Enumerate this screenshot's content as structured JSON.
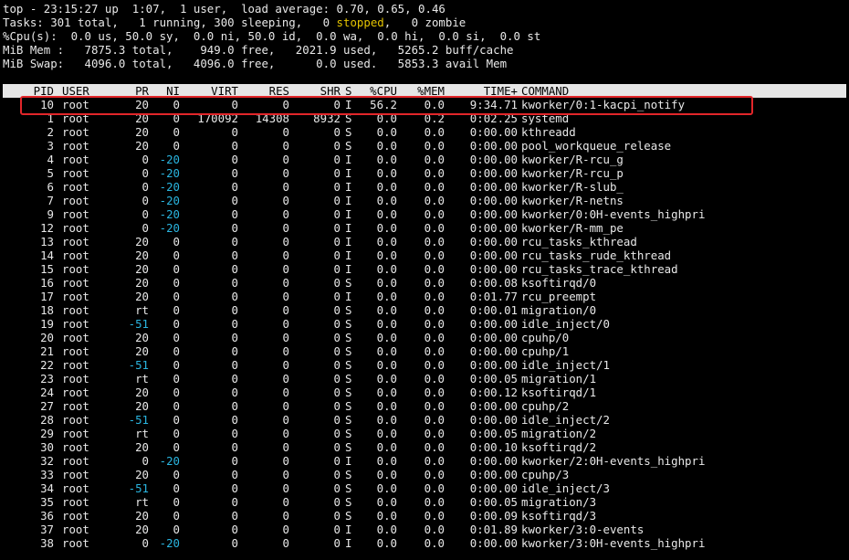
{
  "summary": {
    "line1": "top - 23:15:27 up  1:07,  1 user,  load average: 0.70, 0.65, 0.46",
    "tasks_pre": "Tasks: 301 total,   1 running, 300 sleeping,   0 ",
    "tasks_stopped": "stopped",
    "tasks_post": ",   0 zombie",
    "cpu": "%Cpu(s):  0.0 us, 50.0 sy,  0.0 ni, 50.0 id,  0.0 wa,  0.0 hi,  0.0 si,  0.0 st",
    "mem": "MiB Mem :   7875.3 total,    949.0 free,   2021.9 used,   5265.2 buff/cache",
    "swap": "MiB Swap:   4096.0 total,   4096.0 free,      0.0 used.   5853.3 avail Mem"
  },
  "columns": {
    "pid": "PID",
    "user": "USER",
    "pr": "PR",
    "ni": "NI",
    "virt": "VIRT",
    "res": "RES",
    "shr": "SHR",
    "s": "S",
    "cpu": "%CPU",
    "mem": "%MEM",
    "time": "TIME+",
    "command": "COMMAND"
  },
  "colors": {
    "background": "#000000",
    "text": "#e8e8e8",
    "header_bg": "#e6e6e6",
    "negative_ni": "#2ab5e0",
    "stopped": "#e5c400",
    "highlight": "#e2262a"
  },
  "processes": [
    {
      "pid": "10",
      "user": "root",
      "pr": "20",
      "ni": "0",
      "virt": "0",
      "res": "0",
      "shr": "0",
      "s": "I",
      "cpu": "56.2",
      "mem": "0.0",
      "time": "9:34.71",
      "command": "kworker/0:1-kacpi_notify",
      "highlighted": true
    },
    {
      "pid": "1",
      "user": "root",
      "pr": "20",
      "ni": "0",
      "virt": "170092",
      "res": "14308",
      "shr": "8932",
      "s": "S",
      "cpu": "0.0",
      "mem": "0.2",
      "time": "0:02.25",
      "command": "systemd"
    },
    {
      "pid": "2",
      "user": "root",
      "pr": "20",
      "ni": "0",
      "virt": "0",
      "res": "0",
      "shr": "0",
      "s": "S",
      "cpu": "0.0",
      "mem": "0.0",
      "time": "0:00.00",
      "command": "kthreadd"
    },
    {
      "pid": "3",
      "user": "root",
      "pr": "20",
      "ni": "0",
      "virt": "0",
      "res": "0",
      "shr": "0",
      "s": "S",
      "cpu": "0.0",
      "mem": "0.0",
      "time": "0:00.00",
      "command": "pool_workqueue_release"
    },
    {
      "pid": "4",
      "user": "root",
      "pr": "0",
      "ni": "-20",
      "virt": "0",
      "res": "0",
      "shr": "0",
      "s": "I",
      "cpu": "0.0",
      "mem": "0.0",
      "time": "0:00.00",
      "command": "kworker/R-rcu_g"
    },
    {
      "pid": "5",
      "user": "root",
      "pr": "0",
      "ni": "-20",
      "virt": "0",
      "res": "0",
      "shr": "0",
      "s": "I",
      "cpu": "0.0",
      "mem": "0.0",
      "time": "0:00.00",
      "command": "kworker/R-rcu_p"
    },
    {
      "pid": "6",
      "user": "root",
      "pr": "0",
      "ni": "-20",
      "virt": "0",
      "res": "0",
      "shr": "0",
      "s": "I",
      "cpu": "0.0",
      "mem": "0.0",
      "time": "0:00.00",
      "command": "kworker/R-slub_"
    },
    {
      "pid": "7",
      "user": "root",
      "pr": "0",
      "ni": "-20",
      "virt": "0",
      "res": "0",
      "shr": "0",
      "s": "I",
      "cpu": "0.0",
      "mem": "0.0",
      "time": "0:00.00",
      "command": "kworker/R-netns"
    },
    {
      "pid": "9",
      "user": "root",
      "pr": "0",
      "ni": "-20",
      "virt": "0",
      "res": "0",
      "shr": "0",
      "s": "I",
      "cpu": "0.0",
      "mem": "0.0",
      "time": "0:00.00",
      "command": "kworker/0:0H-events_highpri"
    },
    {
      "pid": "12",
      "user": "root",
      "pr": "0",
      "ni": "-20",
      "virt": "0",
      "res": "0",
      "shr": "0",
      "s": "I",
      "cpu": "0.0",
      "mem": "0.0",
      "time": "0:00.00",
      "command": "kworker/R-mm_pe"
    },
    {
      "pid": "13",
      "user": "root",
      "pr": "20",
      "ni": "0",
      "virt": "0",
      "res": "0",
      "shr": "0",
      "s": "I",
      "cpu": "0.0",
      "mem": "0.0",
      "time": "0:00.00",
      "command": "rcu_tasks_kthread"
    },
    {
      "pid": "14",
      "user": "root",
      "pr": "20",
      "ni": "0",
      "virt": "0",
      "res": "0",
      "shr": "0",
      "s": "I",
      "cpu": "0.0",
      "mem": "0.0",
      "time": "0:00.00",
      "command": "rcu_tasks_rude_kthread"
    },
    {
      "pid": "15",
      "user": "root",
      "pr": "20",
      "ni": "0",
      "virt": "0",
      "res": "0",
      "shr": "0",
      "s": "I",
      "cpu": "0.0",
      "mem": "0.0",
      "time": "0:00.00",
      "command": "rcu_tasks_trace_kthread"
    },
    {
      "pid": "16",
      "user": "root",
      "pr": "20",
      "ni": "0",
      "virt": "0",
      "res": "0",
      "shr": "0",
      "s": "S",
      "cpu": "0.0",
      "mem": "0.0",
      "time": "0:00.08",
      "command": "ksoftirqd/0"
    },
    {
      "pid": "17",
      "user": "root",
      "pr": "20",
      "ni": "0",
      "virt": "0",
      "res": "0",
      "shr": "0",
      "s": "I",
      "cpu": "0.0",
      "mem": "0.0",
      "time": "0:01.77",
      "command": "rcu_preempt"
    },
    {
      "pid": "18",
      "user": "root",
      "pr": "rt",
      "ni": "0",
      "virt": "0",
      "res": "0",
      "shr": "0",
      "s": "S",
      "cpu": "0.0",
      "mem": "0.0",
      "time": "0:00.01",
      "command": "migration/0"
    },
    {
      "pid": "19",
      "user": "root",
      "pr": "-51",
      "ni": "0",
      "virt": "0",
      "res": "0",
      "shr": "0",
      "s": "S",
      "cpu": "0.0",
      "mem": "0.0",
      "time": "0:00.00",
      "command": "idle_inject/0"
    },
    {
      "pid": "20",
      "user": "root",
      "pr": "20",
      "ni": "0",
      "virt": "0",
      "res": "0",
      "shr": "0",
      "s": "S",
      "cpu": "0.0",
      "mem": "0.0",
      "time": "0:00.00",
      "command": "cpuhp/0"
    },
    {
      "pid": "21",
      "user": "root",
      "pr": "20",
      "ni": "0",
      "virt": "0",
      "res": "0",
      "shr": "0",
      "s": "S",
      "cpu": "0.0",
      "mem": "0.0",
      "time": "0:00.00",
      "command": "cpuhp/1"
    },
    {
      "pid": "22",
      "user": "root",
      "pr": "-51",
      "ni": "0",
      "virt": "0",
      "res": "0",
      "shr": "0",
      "s": "S",
      "cpu": "0.0",
      "mem": "0.0",
      "time": "0:00.00",
      "command": "idle_inject/1"
    },
    {
      "pid": "23",
      "user": "root",
      "pr": "rt",
      "ni": "0",
      "virt": "0",
      "res": "0",
      "shr": "0",
      "s": "S",
      "cpu": "0.0",
      "mem": "0.0",
      "time": "0:00.05",
      "command": "migration/1"
    },
    {
      "pid": "24",
      "user": "root",
      "pr": "20",
      "ni": "0",
      "virt": "0",
      "res": "0",
      "shr": "0",
      "s": "S",
      "cpu": "0.0",
      "mem": "0.0",
      "time": "0:00.12",
      "command": "ksoftirqd/1"
    },
    {
      "pid": "27",
      "user": "root",
      "pr": "20",
      "ni": "0",
      "virt": "0",
      "res": "0",
      "shr": "0",
      "s": "S",
      "cpu": "0.0",
      "mem": "0.0",
      "time": "0:00.00",
      "command": "cpuhp/2"
    },
    {
      "pid": "28",
      "user": "root",
      "pr": "-51",
      "ni": "0",
      "virt": "0",
      "res": "0",
      "shr": "0",
      "s": "S",
      "cpu": "0.0",
      "mem": "0.0",
      "time": "0:00.00",
      "command": "idle_inject/2"
    },
    {
      "pid": "29",
      "user": "root",
      "pr": "rt",
      "ni": "0",
      "virt": "0",
      "res": "0",
      "shr": "0",
      "s": "S",
      "cpu": "0.0",
      "mem": "0.0",
      "time": "0:00.05",
      "command": "migration/2"
    },
    {
      "pid": "30",
      "user": "root",
      "pr": "20",
      "ni": "0",
      "virt": "0",
      "res": "0",
      "shr": "0",
      "s": "S",
      "cpu": "0.0",
      "mem": "0.0",
      "time": "0:00.10",
      "command": "ksoftirqd/2"
    },
    {
      "pid": "32",
      "user": "root",
      "pr": "0",
      "ni": "-20",
      "virt": "0",
      "res": "0",
      "shr": "0",
      "s": "I",
      "cpu": "0.0",
      "mem": "0.0",
      "time": "0:00.00",
      "command": "kworker/2:0H-events_highpri"
    },
    {
      "pid": "33",
      "user": "root",
      "pr": "20",
      "ni": "0",
      "virt": "0",
      "res": "0",
      "shr": "0",
      "s": "S",
      "cpu": "0.0",
      "mem": "0.0",
      "time": "0:00.00",
      "command": "cpuhp/3"
    },
    {
      "pid": "34",
      "user": "root",
      "pr": "-51",
      "ni": "0",
      "virt": "0",
      "res": "0",
      "shr": "0",
      "s": "S",
      "cpu": "0.0",
      "mem": "0.0",
      "time": "0:00.00",
      "command": "idle_inject/3"
    },
    {
      "pid": "35",
      "user": "root",
      "pr": "rt",
      "ni": "0",
      "virt": "0",
      "res": "0",
      "shr": "0",
      "s": "S",
      "cpu": "0.0",
      "mem": "0.0",
      "time": "0:00.05",
      "command": "migration/3"
    },
    {
      "pid": "36",
      "user": "root",
      "pr": "20",
      "ni": "0",
      "virt": "0",
      "res": "0",
      "shr": "0",
      "s": "S",
      "cpu": "0.0",
      "mem": "0.0",
      "time": "0:00.09",
      "command": "ksoftirqd/3"
    },
    {
      "pid": "37",
      "user": "root",
      "pr": "20",
      "ni": "0",
      "virt": "0",
      "res": "0",
      "shr": "0",
      "s": "I",
      "cpu": "0.0",
      "mem": "0.0",
      "time": "0:01.89",
      "command": "kworker/3:0-events"
    },
    {
      "pid": "38",
      "user": "root",
      "pr": "0",
      "ni": "-20",
      "virt": "0",
      "res": "0",
      "shr": "0",
      "s": "I",
      "cpu": "0.0",
      "mem": "0.0",
      "time": "0:00.00",
      "command": "kworker/3:0H-events_highpri"
    }
  ]
}
